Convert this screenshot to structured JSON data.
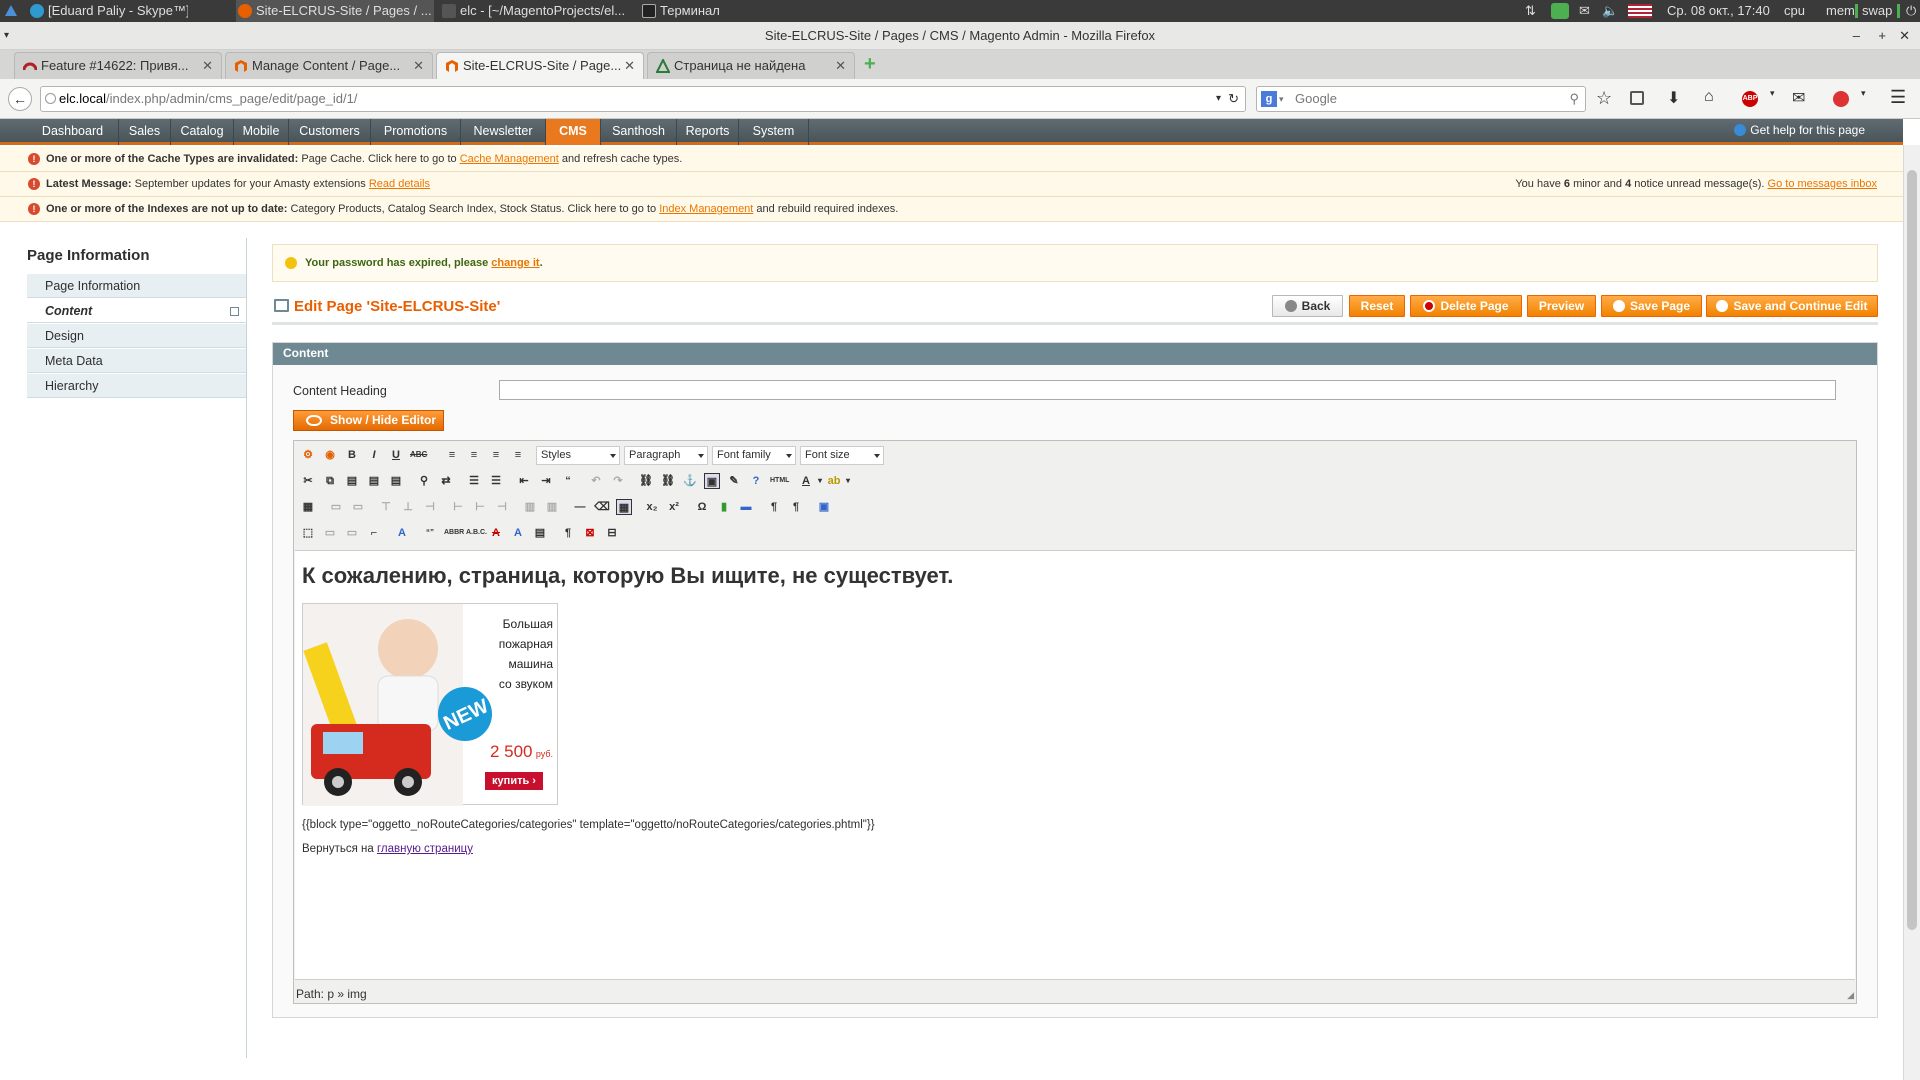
{
  "os_panel": {
    "tasks": [
      {
        "label": "[Eduard Paliy - Skype™]"
      },
      {
        "label": "Site-ELCRUS-Site / Pages / ..."
      },
      {
        "label": "elc - [~/MagentoProjects/el..."
      },
      {
        "label": "Терминал"
      }
    ],
    "datetime": "Ср. 08 окт., 17:40",
    "cpu": "cpu",
    "mem": "mem",
    "swap": "swap"
  },
  "browser": {
    "window_title": "Site-ELCRUS-Site / Pages / CMS / Magento Admin - Mozilla Firefox",
    "tabs": [
      {
        "label": "Feature #14622: Привя..."
      },
      {
        "label": "Manage Content / Page..."
      },
      {
        "label": "Site-ELCRUS-Site / Page..."
      },
      {
        "label": "Страница не найдена"
      }
    ],
    "url_host": "elc.local",
    "url_path": "/index.php/admin/cms_page/edit/page_id/1/",
    "search_placeholder": "Google"
  },
  "admin_nav": {
    "items": [
      "Dashboard",
      "Sales",
      "Catalog",
      "Mobile",
      "Customers",
      "Promotions",
      "Newsletter",
      "CMS",
      "Santhosh",
      "Reports",
      "System"
    ],
    "active": "CMS",
    "help": "Get help for this page"
  },
  "notices": {
    "cache_bold": "One or more of the Cache Types are invalidated:",
    "cache_text": "Page Cache. Click here to go to",
    "cache_link": "Cache Management",
    "cache_tail": "and refresh cache types.",
    "latest_bold": "Latest Message:",
    "latest_text": "September updates for your Amasty extensions",
    "latest_link": "Read details",
    "inbox_pre": "You have",
    "inbox_minor": "6",
    "inbox_mid": "minor and",
    "inbox_notice": "4",
    "inbox_post": "notice unread message(s).",
    "inbox_link": "Go to messages inbox",
    "index_bold": "One or more of the Indexes are not up to date:",
    "index_text": "Category Products, Catalog Search Index, Stock Status. Click here to go to",
    "index_link": "Index Management",
    "index_tail": "and rebuild required indexes."
  },
  "sidebar": {
    "title": "Page Information",
    "items": [
      "Page Information",
      "Content",
      "Design",
      "Meta Data",
      "Hierarchy"
    ],
    "active": "Content"
  },
  "password_msg": {
    "text": "Your password has expired, please",
    "link": "change it",
    "tail": "."
  },
  "page": {
    "title": "Edit Page 'Site-ELCRUS-Site'",
    "buttons": {
      "back": "Back",
      "reset": "Reset",
      "delete": "Delete Page",
      "preview": "Preview",
      "save": "Save Page",
      "save_continue": "Save and Continue Edit"
    },
    "section": "Content",
    "content_heading_label": "Content Heading",
    "content_heading_value": "",
    "show_hide": "Show / Hide Editor"
  },
  "editor": {
    "styles": "Styles",
    "format": "Paragraph",
    "font_family": "Font family",
    "font_size": "Font size",
    "heading": "К сожалению, страница, которую Вы ищите, не существует.",
    "promo": {
      "line1": "Большая",
      "line2": "пожарная",
      "line3": "машина",
      "line4": "со звуком",
      "price": "2 500",
      "currency": "руб.",
      "buy": "купить ›",
      "badge": "NEW"
    },
    "block_directive": "{{block type=\"oggetto_noRouteCategories/categories\" template=\"oggetto/noRouteCategories/categories.phtml\"}}",
    "back_text": "Вернуться на",
    "back_link": "главную страницу",
    "path": "Path: p » img"
  },
  "colors": {
    "accent": "#eb5e00",
    "nav_bg": "#55636a",
    "section_header": "#6f8992"
  }
}
